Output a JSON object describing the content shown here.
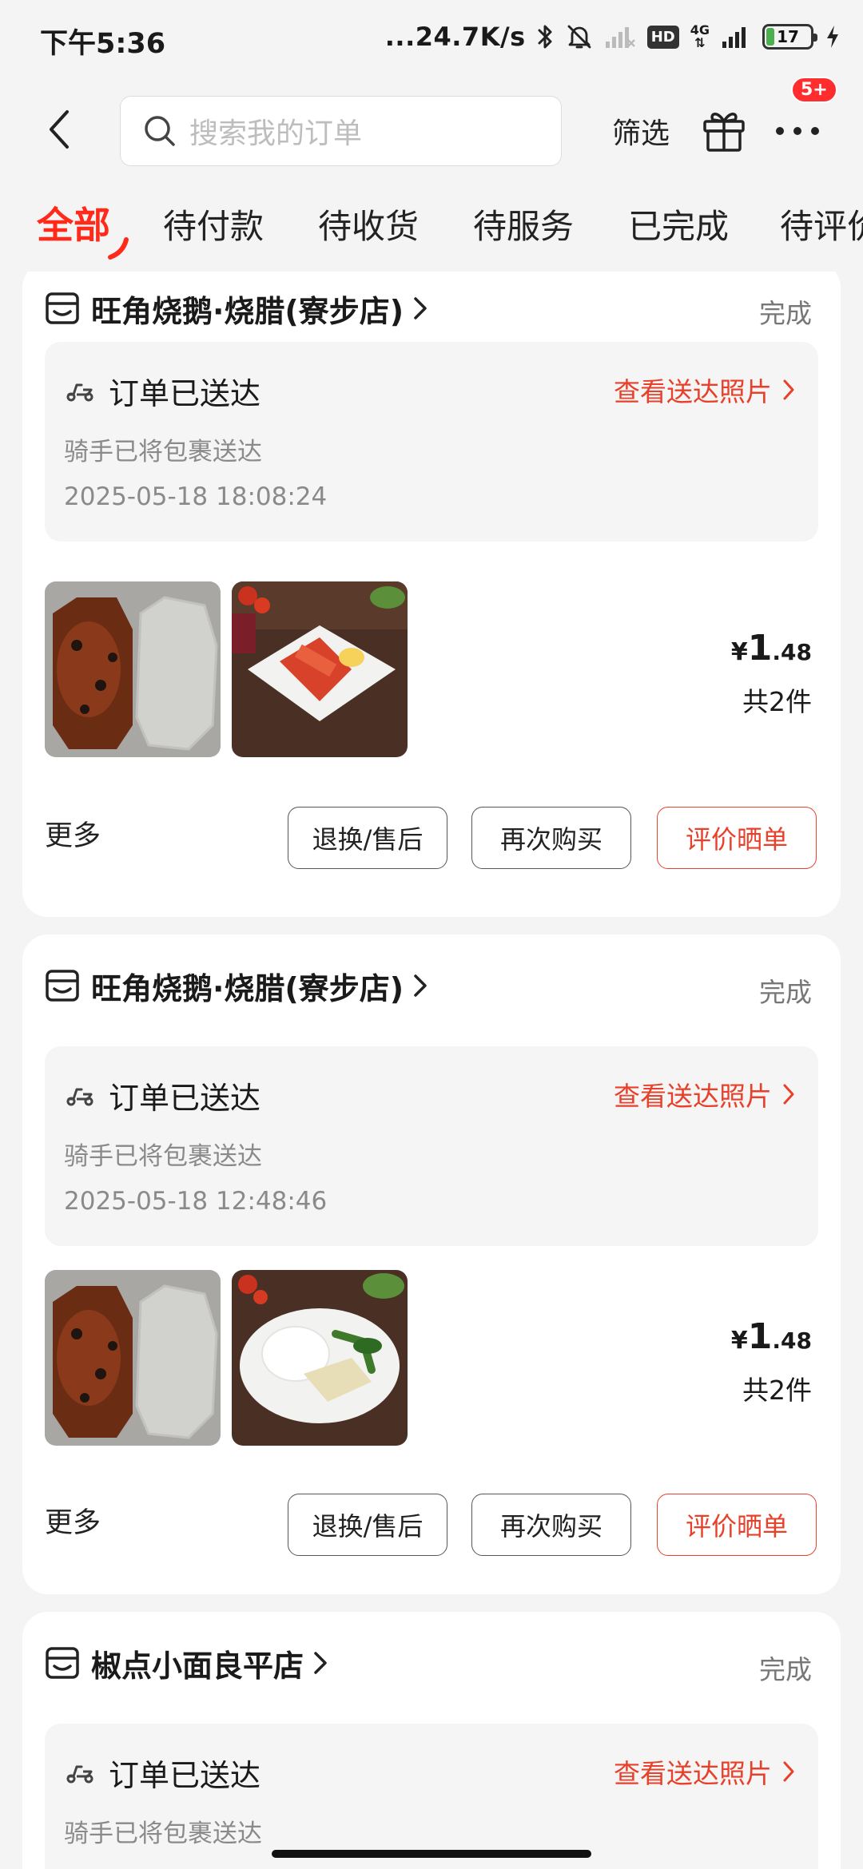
{
  "status_bar": {
    "time": "下午5:36",
    "net_speed": "...24.7K/s",
    "hd": "HD",
    "network": "4G",
    "battery": "17",
    "battery_level": 0.17
  },
  "header": {
    "search_placeholder": "搜索我的订单",
    "filter_label": "筛选",
    "message_badge": "5+"
  },
  "tabs": [
    {
      "label": "全部",
      "active": true
    },
    {
      "label": "待付款"
    },
    {
      "label": "待收货"
    },
    {
      "label": "待服务"
    },
    {
      "label": "已完成"
    },
    {
      "label": "待评价"
    }
  ],
  "orders": [
    {
      "store": "旺角烧鹅·烧腊(寮步店)",
      "status": "完成",
      "delivery_title": "订单已送达",
      "delivery_link": "查看送达照片",
      "delivery_sub": "骑手已将包裹送达",
      "delivery_time": "2025-05-18 18:08:24",
      "price_symbol": "¥",
      "price_int": "1",
      "price_dec": ".48",
      "quantity": "共2件",
      "more": "更多",
      "buttons": [
        "退换/售后",
        "再次购买",
        "评价晒单"
      ]
    },
    {
      "store": "旺角烧鹅·烧腊(寮步店)",
      "status": "完成",
      "delivery_title": "订单已送达",
      "delivery_link": "查看送达照片",
      "delivery_sub": "骑手已将包裹送达",
      "delivery_time": "2025-05-18 12:48:46",
      "price_symbol": "¥",
      "price_int": "1",
      "price_dec": ".48",
      "quantity": "共2件",
      "more": "更多",
      "buttons": [
        "退换/售后",
        "再次购买",
        "评价晒单"
      ]
    },
    {
      "store": "椒点小面良平店",
      "status": "完成",
      "delivery_title": "订单已送达",
      "delivery_link": "查看送达照片",
      "delivery_sub": "骑手已将包裹送达"
    }
  ],
  "colors": {
    "accent": "#ff2a1a",
    "link_red": "#e8402a",
    "background": "#f4f4f4"
  }
}
